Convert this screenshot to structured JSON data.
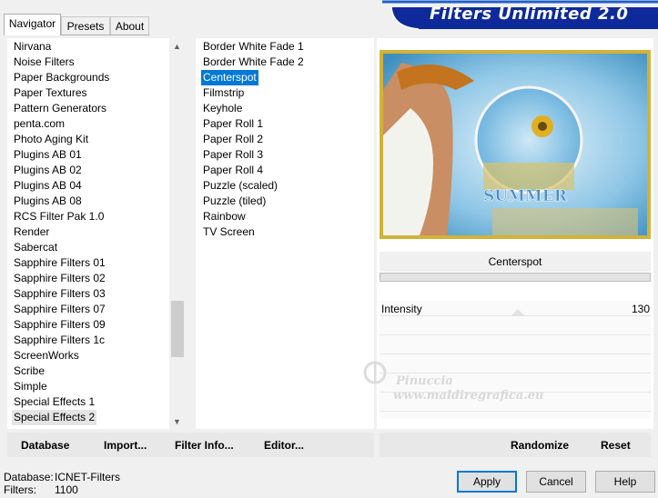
{
  "tabs": [
    {
      "label": "Navigator",
      "active": true
    },
    {
      "label": "Presets",
      "active": false
    },
    {
      "label": "About",
      "active": false
    }
  ],
  "app_title": "Filters Unlimited 2.0",
  "categories": [
    "Nirvana",
    "Noise Filters",
    "Paper Backgrounds",
    "Paper Textures",
    "Pattern Generators",
    "penta.com",
    "Photo Aging Kit",
    "Plugins AB 01",
    "Plugins AB 02",
    "Plugins AB 04",
    "Plugins AB 08",
    "RCS Filter Pak 1.0",
    "Render",
    "Sabercat",
    "Sapphire Filters 01",
    "Sapphire Filters 02",
    "Sapphire Filters 03",
    "Sapphire Filters 07",
    "Sapphire Filters 09",
    "Sapphire Filters 1c",
    "ScreenWorks",
    "Scribe",
    "Simple",
    "Special Effects 1",
    "Special Effects 2"
  ],
  "selected_category": "Special Effects 2",
  "filters": [
    "Border White Fade 1",
    "Border White Fade 2",
    "Centerspot",
    "Filmstrip",
    "Keyhole",
    "Paper Roll 1",
    "Paper Roll 2",
    "Paper Roll 3",
    "Paper Roll 4",
    "Puzzle (scaled)",
    "Puzzle (tiled)",
    "Rainbow",
    "TV Screen"
  ],
  "selected_filter": "Centerspot",
  "left_bar": {
    "database": "Database",
    "import": "Import...",
    "filter_info": "Filter Info...",
    "editor": "Editor..."
  },
  "right_bar": {
    "randomize": "Randomize",
    "reset": "Reset"
  },
  "preview": {
    "text": "SUMMER"
  },
  "filter_name": "Centerspot",
  "params": [
    {
      "label": "Intensity",
      "value": "130"
    }
  ],
  "status": {
    "database_label": "Database:",
    "database_value": "ICNET-Filters",
    "filters_label": "Filters:",
    "filters_value": "1100"
  },
  "buttons": {
    "apply": "Apply",
    "cancel": "Cancel",
    "help": "Help"
  },
  "watermark": {
    "line1": "Pinuccia",
    "line2": "www.maldiregrafica.eu"
  },
  "colors": {
    "selection": "#0078d7",
    "banner": "#0e2a9a",
    "preview_frame": "#d2b238"
  }
}
